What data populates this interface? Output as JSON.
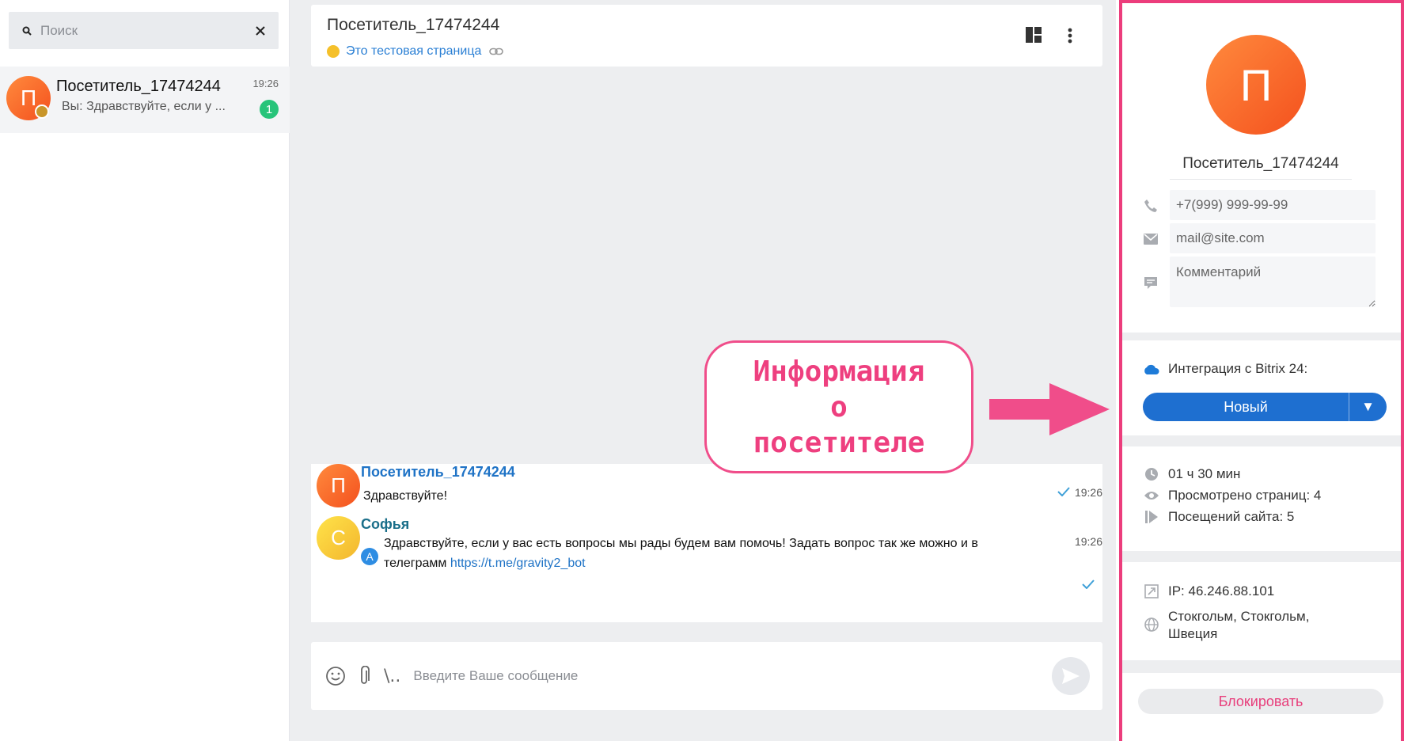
{
  "sidebar": {
    "search": {
      "placeholder": "Поиск"
    },
    "chats": [
      {
        "avatar_letter": "П",
        "name": "Посетитель_17474244",
        "time": "19:26",
        "preview": "Вы: Здравствуйте, если у ...",
        "unread": "1"
      }
    ]
  },
  "chat": {
    "title": "Посетитель_17474244",
    "page_link": "Это тестовая страница",
    "messages": [
      {
        "avatar_letter": "П",
        "author": "Посетитель_17474244",
        "text": "Здравствуйте!",
        "time": "19:26"
      },
      {
        "avatar_letter": "С",
        "author": "Софья",
        "agent_letter": "A",
        "text": "Здравствуйте, если у вас есть вопросы мы рады будем вам помочь! Задать вопрос так же можно и в телеграмм ",
        "link": "https://t.me/gravity2_bot",
        "time": "19:26"
      }
    ],
    "composer": {
      "placeholder": "Введите Ваше сообщение",
      "commands": "\\.."
    }
  },
  "annotation": {
    "line1": "Информация",
    "line2": "о",
    "line3": "посетителе"
  },
  "visitor": {
    "avatar_letter": "П",
    "name": "Посетитель_17474244",
    "phone_placeholder": "+7(999) 999-99-99",
    "email_placeholder": "mail@site.com",
    "comment_placeholder": "Комментарий",
    "bitrix_label": "Интеграция с Bitrix 24:",
    "bitrix_status": "Новый",
    "duration": "01 ч 30 мин",
    "pages_viewed": "Просмотрено страниц: 4",
    "visits": "Посещений сайта: 5",
    "ip": "IP: 46.246.88.101",
    "location": "Стокгольм, Стокгольм, Швеция",
    "block_label": "Блокировать"
  },
  "colors": {
    "accent": "#1e6fd0",
    "highlight": "#ec3d7c",
    "unread": "#27c47a"
  }
}
